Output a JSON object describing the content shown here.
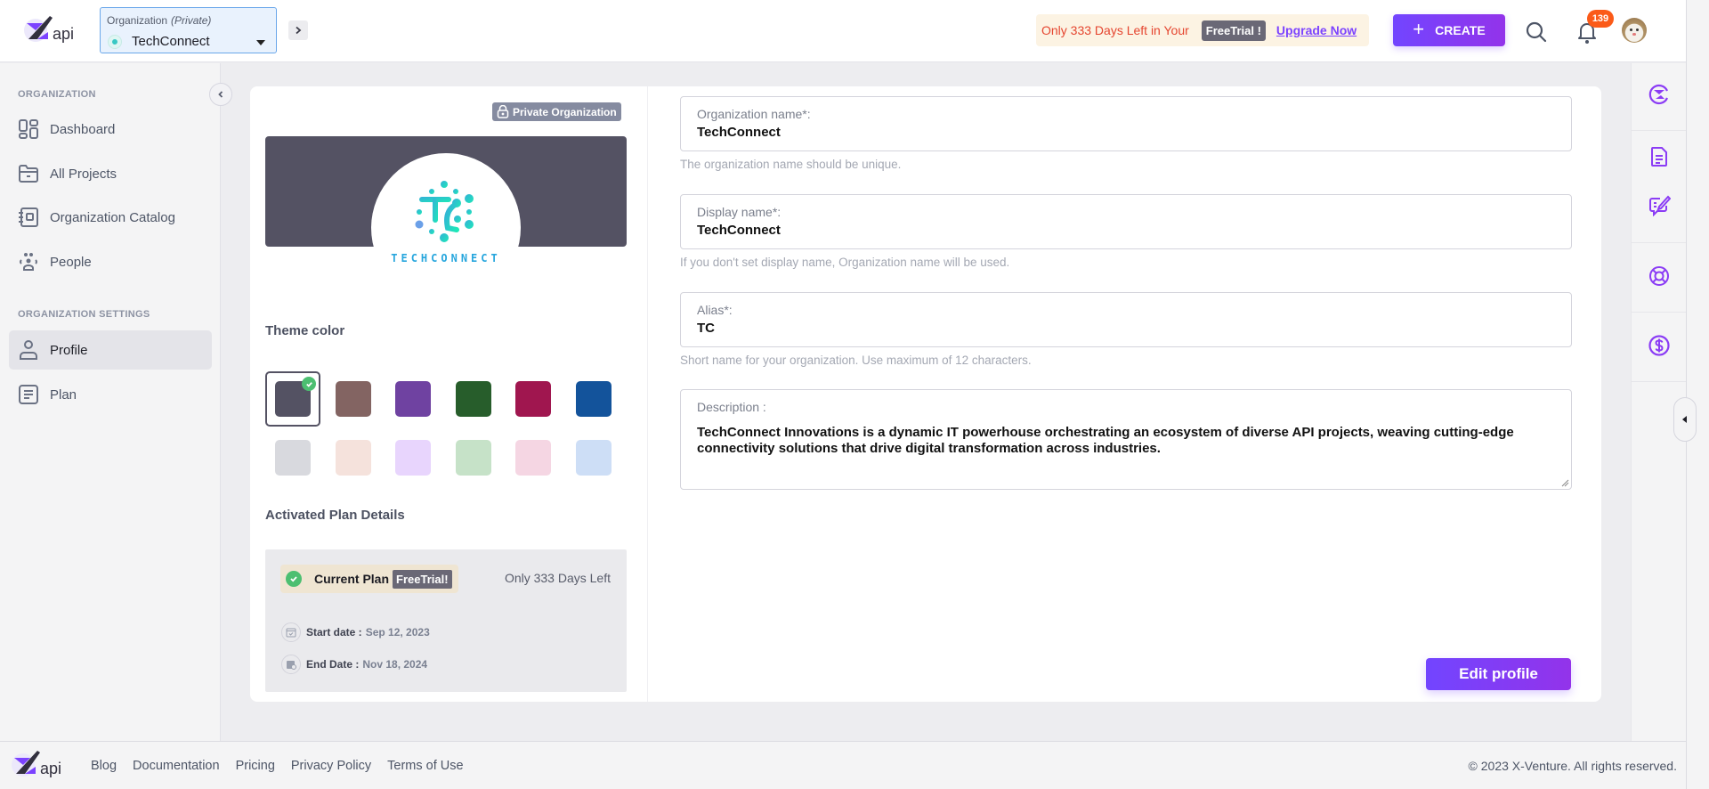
{
  "header": {
    "org_selector": {
      "label": "Organization",
      "visibility": "(Private)",
      "selected": "TechConnect"
    },
    "trial_banner": {
      "message": "Only 333 Days Left in Your",
      "plan_tag": "FreeTrial !",
      "upgrade_link": "Upgrade Now"
    },
    "create_button": "CREATE",
    "notification_count": "139",
    "colors": {
      "accent": "#7c43ff",
      "badge": "#fb5a18",
      "warning_text": "#e5452f"
    }
  },
  "sidebar": {
    "section_organization": "ORGANIZATION",
    "items": [
      {
        "label": "Dashboard",
        "icon": "dashboard-icon"
      },
      {
        "label": "All Projects",
        "icon": "folder-icon"
      },
      {
        "label": "Organization Catalog",
        "icon": "catalog-icon"
      },
      {
        "label": "People",
        "icon": "people-icon"
      }
    ],
    "section_settings": "ORGANIZATION SETTINGS",
    "settings_items": [
      {
        "label": "Profile",
        "icon": "user-icon",
        "active": true
      },
      {
        "label": "Plan",
        "icon": "plan-icon",
        "active": false
      }
    ]
  },
  "profile": {
    "private_badge": "Private Organization",
    "logo_text": "TECHCONNECT",
    "theme_color_title": "Theme color",
    "theme_colors": {
      "dark": [
        "#545263",
        "#836462",
        "#6f42a1",
        "#275d2b",
        "#a0164f",
        "#13539b"
      ],
      "light": [
        "#d8d9de",
        "#f5e2dc",
        "#e8d5fd",
        "#c6e2c8",
        "#f5d6e3",
        "#cddef6"
      ],
      "selected": "#545263"
    },
    "plan_section_title": "Activated Plan Details",
    "plan": {
      "current_label": "Current Plan",
      "plan_name": "FreeTrial!",
      "days_left": "Only 333 Days Left",
      "start_label": "Start date :",
      "start_value": "Sep 12, 2023",
      "end_label": "End Date :",
      "end_value": "Nov 18, 2024"
    }
  },
  "form": {
    "org_name": {
      "label": "Organization name*:",
      "value": "TechConnect",
      "hint": "The organization name should be unique."
    },
    "display_name": {
      "label": "Display name*:",
      "value": "TechConnect",
      "hint": "If you don't set display name, Organization name will be used."
    },
    "alias": {
      "label": "Alias*:",
      "value": "TC",
      "hint": "Short name for your organization. Use maximum of 12 characters."
    },
    "description": {
      "label": "Description :",
      "value": "TechConnect Innovations is a dynamic IT powerhouse orchestrating an ecosystem of diverse API projects, weaving cutting-edge connectivity solutions that drive digital transformation across industries."
    },
    "edit_button": "Edit profile"
  },
  "right_rail": {
    "icons": [
      "x-logo-icon",
      "document-icon",
      "feedback-icon",
      "support-icon",
      "dollar-icon"
    ]
  },
  "footer": {
    "links": [
      "Blog",
      "Documentation",
      "Pricing",
      "Privacy Policy",
      "Terms of Use"
    ],
    "copyright": "© 2023 X-Venture. All rights reserved."
  }
}
